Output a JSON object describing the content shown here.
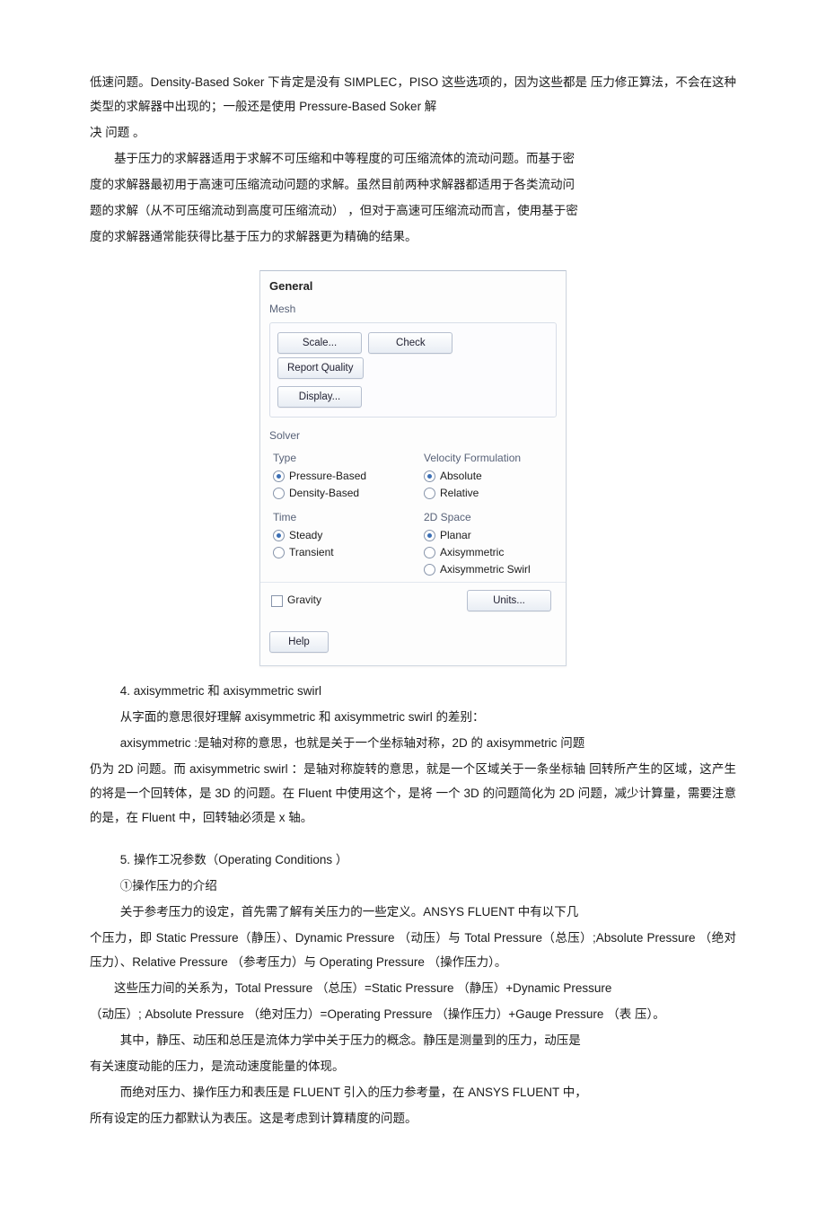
{
  "doc": {
    "p1": "低速问题。Density-Based Soker 下肯定是没有 SIMPLEC，PISO 这些选项的，因为这些都是 压力修正算法，不会在这种类型的求解器中出现的；一般还是使用 Pressure-Based Soker 解",
    "p1b": "决 问题 。",
    "p2": "基于压力的求解器适用于求解不可压缩和中等程度的可压缩流体的流动问题。而基于密",
    "p3": "度的求解器最初用于高速可压缩流动问题的求解。虽然目前两种求解器都适用于各类流动问",
    "p4": "题的求解（从不可压缩流动到高度可压缩流动） ，但对于高速可压缩流动而言，使用基于密",
    "p5": "度的求解器通常能获得比基于压力的求解器更为精确的结果。",
    "s4_title": "4.  axisymmetric 和  axisymmetric swirl",
    "s4_l1": "从字面的意思很好理解 axisymmetric 和 axisymmetric swirl 的差别：",
    "s4_l2": "axisymmetric :是轴对称的意思，也就是关于一个坐标轴对称，2D 的 axisymmetric 问题",
    "s4_p": "仍为 2D 问题。而 axisymmetric swirl ：是轴对称旋转的意思，就是一个区域关于一条坐标轴 回转所产生的区域，这产生的将是一个回转体，是 3D 的问题。在 Fluent 中使用这个，是将 一个 3D 的问题简化为 2D 问题，减少计算量，需要注意的是，在  Fluent 中，回转轴必须是  x 轴。",
    "s5_title": "5.  操作工况参数（Operating Conditions  ）",
    "s5_l1": "①操作压力的介绍",
    "s5_l2": "关于参考压力的设定，首先需了解有关压力的一些定义。ANSYS FLUENT 中有以下几",
    "s5_p1": "个压力，即  Static Pressure（静压）、Dynamic Pressure （动压）与  Total Pressure（总压）;Absolute Pressure （绝对压力）、Relative Pressure （参考压力）与  Operating Pressure （操作压力）。",
    "s5_p2a": "这些压力间的关系为，Total Pressure （总压）=Static Pressure （静压）+Dynamic Pressure",
    "s5_p2b": "（动压）; Absolute Pressure （绝对压力）=Operating Pressure （操作压力）+Gauge Pressure （表 压）。",
    "s5_p3a": "其中，静压、动压和总压是流体力学中关于压力的概念。静压是测量到的压力，动压是",
    "s5_p3b": "有关速度动能的压力，是流动速度能量的体现。",
    "s5_p4a": "而绝对压力、操作压力和表压是 FLUENT 引入的压力参考量，在  ANSYS FLUENT 中，",
    "s5_p4b": "所有设定的压力都默认为表压。这是考虑到计算精度的问题。"
  },
  "ui": {
    "title": "General",
    "mesh_label": "Mesh",
    "btn_scale": "Scale...",
    "btn_check": "Check",
    "btn_report": "Report Quality",
    "btn_display": "Display...",
    "solver_label": "Solver",
    "type_label": "Type",
    "type_pb": "Pressure-Based",
    "type_db": "Density-Based",
    "vel_label": "Velocity Formulation",
    "vel_abs": "Absolute",
    "vel_rel": "Relative",
    "time_label": "Time",
    "time_steady": "Steady",
    "time_trans": "Transient",
    "space_label": "2D Space",
    "space_planar": "Planar",
    "space_axi": "Axisymmetric",
    "space_axis": "Axisymmetric Swirl",
    "gravity": "Gravity",
    "btn_units": "Units...",
    "btn_help": "Help"
  }
}
